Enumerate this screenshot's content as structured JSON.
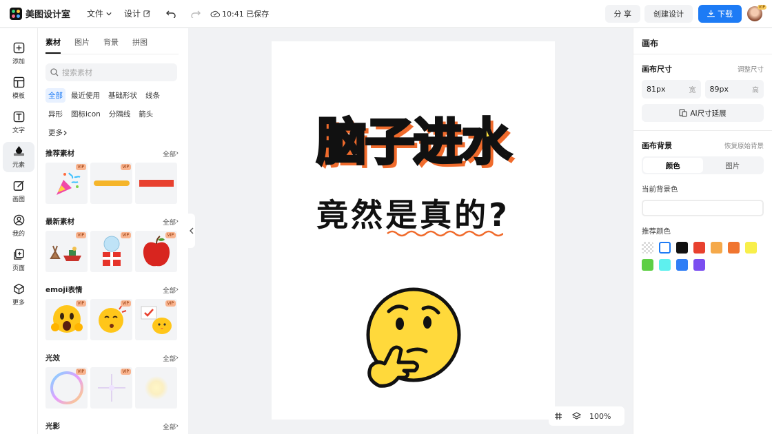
{
  "app": {
    "name": "美图设计室"
  },
  "topbar": {
    "file_menu": "文件",
    "design_menu": "设计",
    "save_status": "10:41 已保存",
    "share_label": "分 享",
    "create_label": "创建设计",
    "download_label": "下载",
    "avatar_badge": "VIP"
  },
  "rail": {
    "items": [
      {
        "label": "添加",
        "icon": "plus-square-icon"
      },
      {
        "label": "模板",
        "icon": "template-icon"
      },
      {
        "label": "文字",
        "icon": "text-icon"
      },
      {
        "label": "元素",
        "icon": "shapes-icon",
        "active": true
      },
      {
        "label": "画图",
        "icon": "pen-icon"
      },
      {
        "label": "我的",
        "icon": "user-icon"
      },
      {
        "label": "页面",
        "icon": "page-add-icon"
      },
      {
        "label": "更多",
        "icon": "cube-icon"
      }
    ]
  },
  "panel": {
    "tabs": [
      "素材",
      "图片",
      "背景",
      "拼图"
    ],
    "search_placeholder": "搜索素材",
    "chips": [
      "全部",
      "最近使用",
      "基础形状",
      "线条",
      "异形",
      "图标icon",
      "分隔线",
      "箭头",
      "更多"
    ],
    "all_label": "全部",
    "vip_badge": "VIP",
    "sections": [
      {
        "title": "推荐素材"
      },
      {
        "title": "最新素材"
      },
      {
        "title": "emoji表情"
      },
      {
        "title": "光效"
      },
      {
        "title": "光影"
      }
    ]
  },
  "canvas": {
    "headline": "脑子进水",
    "subline": "竟然是真的?",
    "zoom": "100%"
  },
  "inspector": {
    "title": "画布",
    "size_label": "画布尺寸",
    "resize_link": "调整尺寸",
    "width_value": "81px",
    "width_unit": "宽",
    "height_value": "89px",
    "height_unit": "高",
    "ai_button": "AI尺寸延展",
    "bg_label": "画布背景",
    "restore_link": "恢复原始背景",
    "seg_color": "颜色",
    "seg_image": "图片",
    "current_bg_label": "当前背景色",
    "recommend_label": "推荐颜色",
    "swatches": [
      "transparent",
      "#ffffff",
      "#111111",
      "#e8412f",
      "#f5a94a",
      "#f07530",
      "#f8ef4a",
      "#5ecf45",
      "#5ef0ee",
      "#2f7ef6",
      "#7b4ef0"
    ]
  }
}
